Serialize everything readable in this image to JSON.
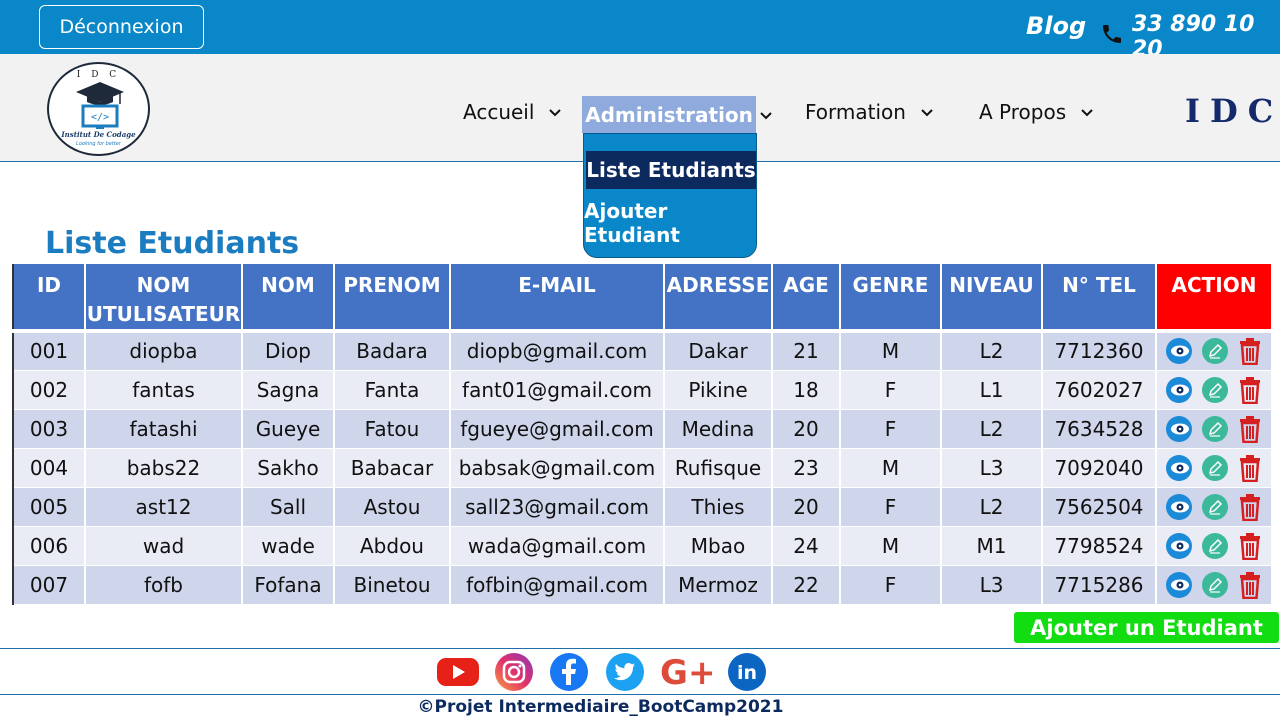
{
  "topbar": {
    "logout_label": "Déconnexion",
    "blog_label": "Blog",
    "phone": "33 890 10 20"
  },
  "logo": {
    "top_text": "I D C",
    "name": "Institut De Codage",
    "tagline": "Looking for better"
  },
  "nav": {
    "items": [
      "Accueil",
      "Administration",
      "Formation",
      "A Propos"
    ],
    "brand": "IDC",
    "dropdown": [
      "Liste Etudiants",
      "Ajouter Etudiant"
    ]
  },
  "page": {
    "title": "Liste Etudiants"
  },
  "table": {
    "headers": [
      "ID",
      "NOM UTULISATEUR",
      "NOM",
      "PRENOM",
      "E-MAIL",
      "ADRESSE",
      "AGE",
      "GENRE",
      "NIVEAU",
      "N° TEL",
      "ACTION"
    ],
    "rows": [
      [
        "001",
        "diopba",
        "Diop",
        "Badara",
        "diopb@gmail.com",
        "Dakar",
        "21",
        "M",
        "L2",
        "7712360"
      ],
      [
        "002",
        "fantas",
        "Sagna",
        "Fanta",
        "fant01@gmail.com",
        "Pikine",
        "18",
        "F",
        "L1",
        "7602027"
      ],
      [
        "003",
        "fatashi",
        "Gueye",
        "Fatou",
        "fgueye@gmail.com",
        "Medina",
        "20",
        "F",
        "L2",
        "7634528"
      ],
      [
        "004",
        "babs22",
        "Sakho",
        "Babacar",
        "babsak@gmail.com",
        "Rufisque",
        "23",
        "M",
        "L3",
        "7092040"
      ],
      [
        "005",
        "ast12",
        "Sall",
        "Astou",
        "sall23@gmail.com",
        "Thies",
        "20",
        "F",
        "L2",
        "7562504"
      ],
      [
        "006",
        "wad",
        "wade",
        "Abdou",
        "wada@gmail.com",
        "Mbao",
        "24",
        "M",
        "M1",
        "7798524"
      ],
      [
        "007",
        "fofb",
        "Fofana",
        "Binetou",
        "fofbin@gmail.com",
        "Mermoz",
        "22",
        "F",
        "L3",
        "7715286"
      ]
    ],
    "action_icons": [
      "view-icon",
      "edit-icon",
      "delete-icon"
    ]
  },
  "add_button_label": "Ajouter un Etudiant",
  "socials": [
    "youtube-icon",
    "instagram-icon",
    "facebook-icon",
    "twitter-icon",
    "google-plus-icon",
    "linkedin-icon"
  ],
  "footer": {
    "copyright": "©Projet Intermediaire_BootCamp2021"
  },
  "colors": {
    "topbar": "#0a87c8",
    "header_blue": "#4472c4",
    "action_red": "#ff0000",
    "row_odd": "#cfd5ea",
    "row_even": "#e9ebf5",
    "add_green": "#11dd11",
    "title_blue": "#1b7cc0"
  }
}
